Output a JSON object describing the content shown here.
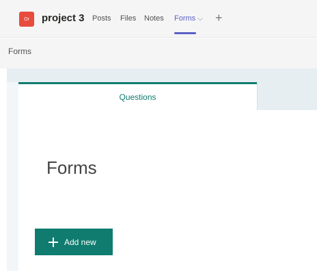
{
  "header": {
    "avatar_text": "Or",
    "team_name": "project 3",
    "tabs": [
      {
        "label": "Posts"
      },
      {
        "label": "Files"
      },
      {
        "label": "Notes"
      },
      {
        "label": "Forms"
      }
    ],
    "add_tab_symbol": "+",
    "dropdown_symbol": "⌵"
  },
  "subheader": {
    "title": "Forms"
  },
  "form_panel": {
    "tab_questions": "Questions",
    "heading": "Forms",
    "add_button_label": "Add new"
  },
  "colors": {
    "accent_teal": "#0f7c6f",
    "active_tab": "#5b5fc7",
    "avatar": "#e74c3c"
  }
}
